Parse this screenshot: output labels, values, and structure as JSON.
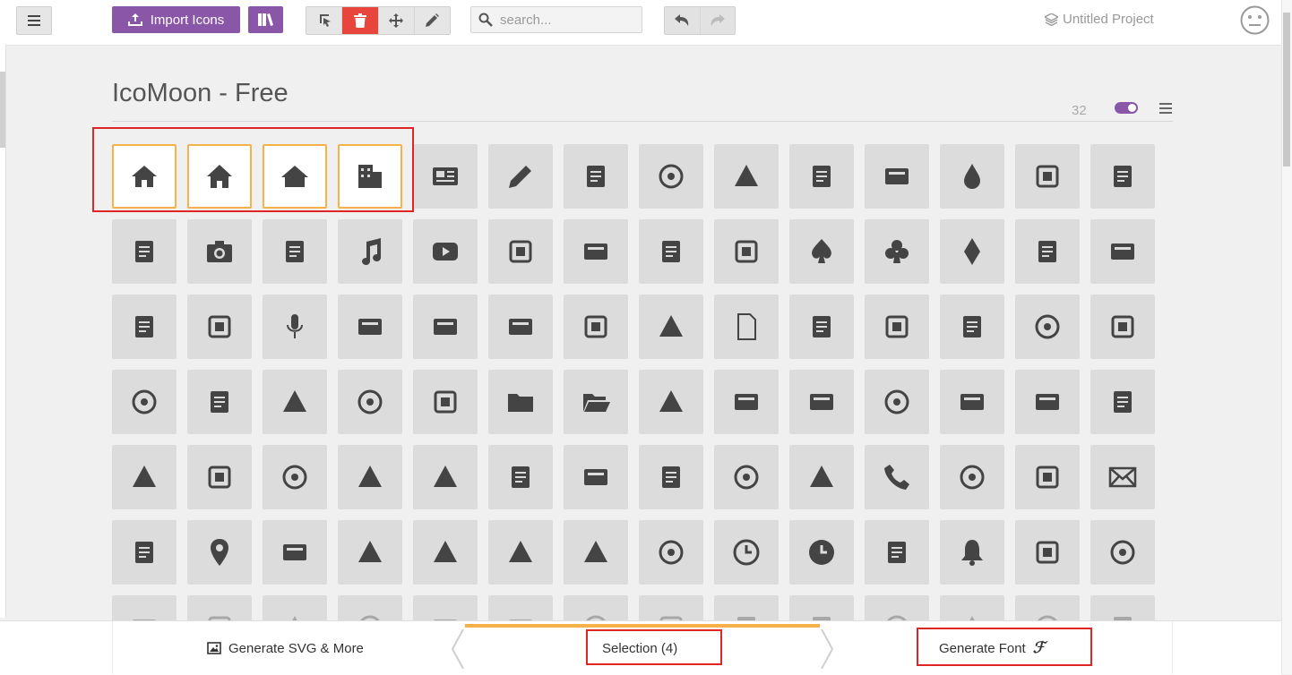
{
  "toolbar": {
    "import_label": "Import Icons",
    "search_placeholder": "search...",
    "project_name": "Untitled Project"
  },
  "icon_set": {
    "title": "IcoMoon - Free",
    "count": "32",
    "accent": "#8a56a8",
    "selection_color": "#f7b14b",
    "annotation_color": "#e02525"
  },
  "icons": [
    [
      "home",
      "home2",
      "home3",
      "office",
      "newspaper",
      "pencil",
      "pencil2",
      "quill",
      "pen",
      "blog",
      "eyedropper",
      "droplet",
      "paint-format",
      "image"
    ],
    [
      "images",
      "camera",
      "headphones",
      "music",
      "play",
      "film",
      "video-camera",
      "dice",
      "pacman",
      "spades",
      "clubs",
      "diamonds",
      "bullhorn",
      "connection"
    ],
    [
      "podcast",
      "feed",
      "mic",
      "book",
      "books",
      "library",
      "file-text",
      "profile",
      "file-empty",
      "files-empty",
      "file-text2",
      "file-picture",
      "file-music",
      "file-play"
    ],
    [
      "file-video",
      "file-zip",
      "copy",
      "paste",
      "stack",
      "folder",
      "folder-open",
      "folder-plus",
      "folder-minus",
      "folder-download",
      "folder-upload",
      "price-tag",
      "price-tags",
      "barcode"
    ],
    [
      "qrcode",
      "ticket",
      "cart",
      "coin-dollar",
      "coin-euro",
      "coin-pound",
      "coin-yen",
      "credit-card",
      "calculator",
      "lifebuoy",
      "phone",
      "phone-hang-up",
      "address-book",
      "envelop"
    ],
    [
      "pushpin",
      "location",
      "location2",
      "compass",
      "compass2",
      "map",
      "map2",
      "history",
      "clock",
      "clock2",
      "alarm",
      "bell",
      "stopwatch",
      "calendar"
    ],
    [
      "printer",
      "keyboard",
      "display",
      "laptop",
      "mobile",
      "mobile2",
      "tablet",
      "tv",
      "drawer",
      "drawer2",
      "box-add",
      "box-remove",
      "download",
      "upload"
    ]
  ],
  "selected_icons": [
    "home",
    "home2",
    "home3",
    "office"
  ],
  "footer": {
    "generate_svg_label": "Generate SVG & More",
    "selection_label": "Selection (4)",
    "generate_font_label": "Generate Font",
    "font_glyph": "ℱ"
  }
}
